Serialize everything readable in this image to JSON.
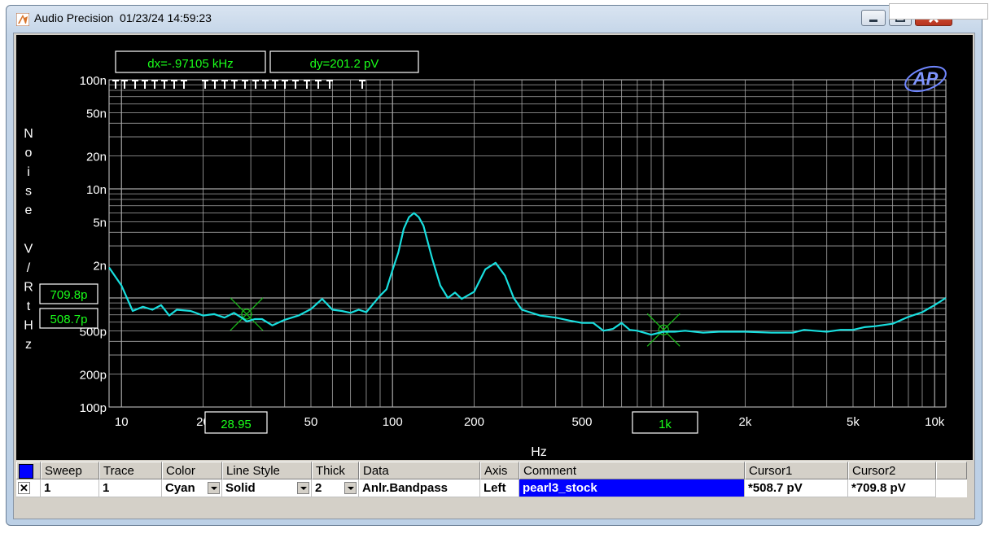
{
  "window": {
    "title": "Audio Precision  01/23/24 14:59:23"
  },
  "cursor_readouts": {
    "dx": "dx=-.97105 kHz",
    "dy": "dy=201.2  pV",
    "y_cursor1": "709.8p",
    "y_cursor2": "508.7p",
    "x_cursor1": "28.95",
    "x_cursor2": "1k"
  },
  "colors": {
    "trace": "#18dede",
    "grid": "#a8a8a8",
    "cursor": "#18b818",
    "readout_text": "#1aff1a",
    "background": "#000000"
  },
  "chart_data": {
    "type": "line",
    "xlabel": "Hz",
    "ylabel": "Noise V/RtHz",
    "xscale": "log",
    "yscale": "log",
    "xlim": [
      9,
      11000
    ],
    "ylim": [
      1e-10,
      1e-07
    ],
    "grid": true,
    "x_tick_labels": [
      {
        "v": 10,
        "t": "10"
      },
      {
        "v": 20,
        "t": "20"
      },
      {
        "v": 50,
        "t": "50"
      },
      {
        "v": 100,
        "t": "100"
      },
      {
        "v": 200,
        "t": "200"
      },
      {
        "v": 500,
        "t": "500"
      },
      {
        "v": 2000,
        "t": "2k"
      },
      {
        "v": 5000,
        "t": "5k"
      },
      {
        "v": 10000,
        "t": "10k"
      }
    ],
    "y_tick_labels": [
      {
        "v": 1e-07,
        "t": "100n"
      },
      {
        "v": 5e-08,
        "t": "50n"
      },
      {
        "v": 2e-08,
        "t": "20n"
      },
      {
        "v": 1e-08,
        "t": "10n"
      },
      {
        "v": 5e-09,
        "t": "5n"
      },
      {
        "v": 2e-09,
        "t": "2n"
      },
      {
        "v": 5e-10,
        "t": "500p"
      },
      {
        "v": 2e-10,
        "t": "200p"
      },
      {
        "v": 1e-10,
        "t": "100p"
      }
    ],
    "series": [
      {
        "x": [
          9,
          10,
          11,
          12,
          13,
          14,
          15,
          16,
          18,
          20,
          22,
          24,
          26,
          28,
          29,
          31,
          33,
          36,
          40,
          45,
          50,
          55,
          60,
          65,
          70,
          75,
          80,
          90,
          95,
          100,
          105,
          110,
          115,
          120,
          125,
          130,
          140,
          150,
          160,
          170,
          180,
          200,
          220,
          240,
          260,
          280,
          300,
          350,
          400,
          450,
          500,
          550,
          600,
          650,
          700,
          750,
          800,
          900,
          1000,
          1100,
          1200,
          1400,
          1600,
          2000,
          2500,
          3000,
          3300,
          3600,
          4000,
          4500,
          5000,
          5500,
          6000,
          7000,
          8000,
          9000,
          10000,
          11000
        ],
        "y": [
          1.9e-09,
          1.3e-09,
          7.6e-10,
          8.3e-10,
          7.8e-10,
          8.6e-10,
          6.9e-10,
          7.8e-10,
          7.6e-10,
          6.9e-10,
          7.1e-10,
          6.6e-10,
          7.3e-10,
          6.5e-10,
          6.1e-10,
          6.4e-10,
          6.4e-10,
          5.6e-10,
          6.3e-10,
          6.9e-10,
          7.9e-10,
          9.8e-10,
          7.8e-10,
          7.6e-10,
          7.3e-10,
          7.8e-10,
          7.4e-10,
          1.05e-09,
          1.2e-09,
          1.8e-09,
          2.6e-09,
          4.3e-09,
          5.5e-09,
          6e-09,
          5.5e-09,
          4.6e-09,
          2.3e-09,
          1.3e-09,
          1e-09,
          1.12e-09,
          9.8e-10,
          1.14e-09,
          1.83e-09,
          2.1e-09,
          1.6e-09,
          1e-09,
          7.8e-10,
          6.9e-10,
          6.6e-10,
          6.2e-10,
          5.9e-10,
          5.9e-10,
          5e-10,
          5.2e-10,
          5.9e-10,
          5.1e-10,
          5e-10,
          4.6e-10,
          4.9e-10,
          4.9e-10,
          5e-10,
          4.8e-10,
          4.9e-10,
          4.9e-10,
          4.8e-10,
          4.8e-10,
          5.1e-10,
          5e-10,
          4.9e-10,
          5.1e-10,
          5.1e-10,
          5.4e-10,
          5.5e-10,
          5.8e-10,
          6.7e-10,
          7.4e-10,
          8.6e-10,
          1e-09
        ]
      }
    ],
    "cursors": [
      {
        "x": 28.95,
        "y": 7.098e-10
      },
      {
        "x": 1000,
        "y": 5.087e-10
      }
    ]
  },
  "legend_table": {
    "headers": {
      "sweep": "Sweep",
      "trace": "Trace",
      "color": "Color",
      "line_style": "Line Style",
      "thick": "Thick",
      "data": "Data",
      "axis": "Axis",
      "comment": "Comment",
      "cursor1": "Cursor1",
      "cursor2": "Cursor2"
    },
    "row": {
      "checkbox": "✕",
      "sweep": "1",
      "trace": "1",
      "color": "Cyan",
      "line_style": "Solid",
      "thick": "2",
      "data": "Anlr.Bandpass",
      "axis": "Left",
      "comment": "pearl3_stock",
      "cursor1": "*508.7  pV",
      "cursor2": "*709.8  pV"
    }
  }
}
